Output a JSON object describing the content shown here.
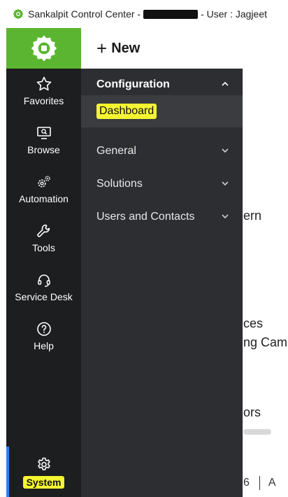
{
  "window": {
    "title_prefix": "Sankalpit Control Center -",
    "title_suffix": "- User : Jagjeet"
  },
  "header": {
    "new_label": "New",
    "brand_color": "#5cb531"
  },
  "sidebar": {
    "items": [
      {
        "label": "Favorites",
        "icon": "star-icon"
      },
      {
        "label": "Browse",
        "icon": "monitor-search-icon"
      },
      {
        "label": "Automation",
        "icon": "gears-icon"
      },
      {
        "label": "Tools",
        "icon": "wrench-icon"
      },
      {
        "label": "Service Desk",
        "icon": "headset-icon"
      },
      {
        "label": "Help",
        "icon": "help-icon"
      },
      {
        "label": "System",
        "icon": "gear-icon",
        "selected": true
      }
    ]
  },
  "flyout": {
    "sections": [
      {
        "label": "Configuration",
        "expanded": true,
        "children": [
          {
            "label": "Dashboard"
          }
        ]
      },
      {
        "label": "General",
        "expanded": false
      },
      {
        "label": "Solutions",
        "expanded": false
      },
      {
        "label": "Users and Contacts",
        "expanded": false
      }
    ]
  },
  "background": {
    "fragments": [
      "ern",
      "ces",
      "ng Cam",
      "ors"
    ],
    "footer_number": "6",
    "footer_tail": "A"
  },
  "colors": {
    "rail": "#1c1e20",
    "flyout": "#2c2e31",
    "highlight": "#f5f531",
    "accent": "#2d7ff9"
  }
}
